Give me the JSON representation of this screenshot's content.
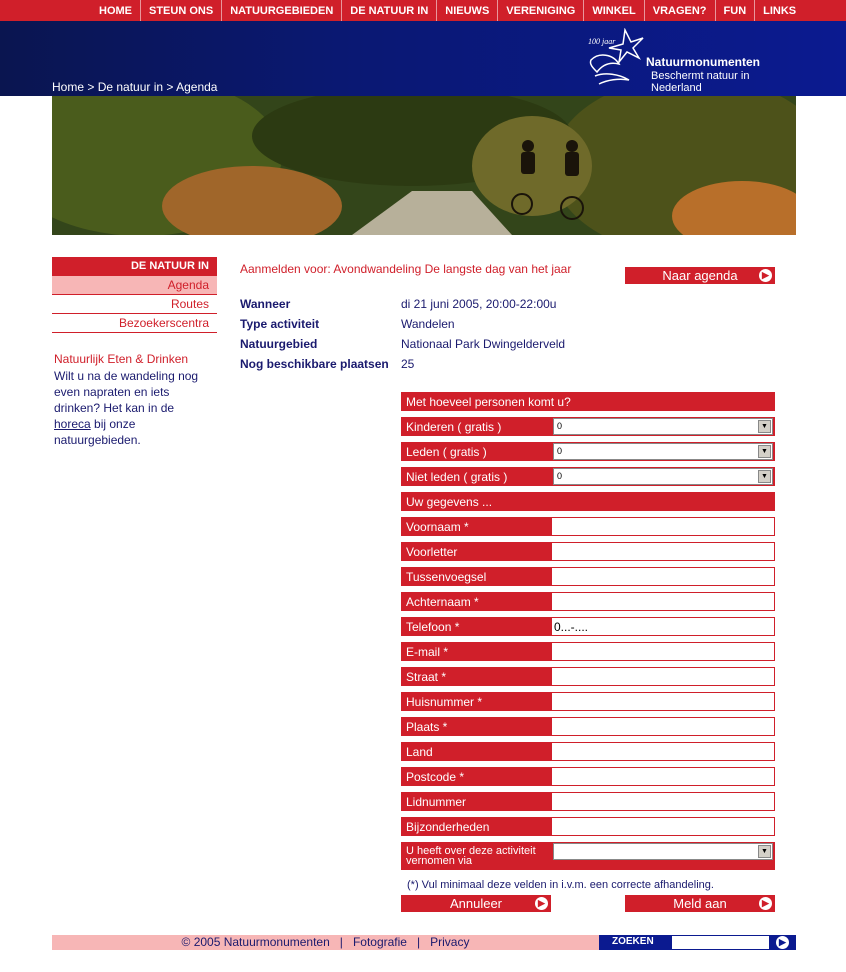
{
  "nav": [
    "HOME",
    "STEUN ONS",
    "NATUURGEBIEDEN",
    "DE NATUUR IN",
    "NIEUWS",
    "VERENIGING",
    "WINKEL",
    "VRAGEN?",
    "FUN",
    "LINKS"
  ],
  "breadcrumb": {
    "home": "Home",
    "sep1": " > ",
    "section": "De natuur in",
    "sep2": " > ",
    "current": "Agenda"
  },
  "logo": {
    "anniversary": "100 jaar",
    "name": "Natuurmonumenten",
    "tagline": "Beschermt natuur in Nederland"
  },
  "sidebar": {
    "heading": "DE NATUUR IN",
    "items": [
      {
        "label": "Agenda",
        "active": true
      },
      {
        "label": "Routes",
        "active": false
      },
      {
        "label": "Bezoekerscentra",
        "active": false
      }
    ],
    "promo_title": "Natuurlijk Eten & Drinken",
    "promo_text_before": "Wilt u na de wandeling nog even napraten en iets drinken? Het kan in de ",
    "promo_link": "horeca",
    "promo_text_after": " bij onze natuurgebieden."
  },
  "main": {
    "title": "Aanmelden voor: Avondwandeling De langste dag van het jaar",
    "agenda_button": "Naar agenda",
    "info": [
      {
        "label": "Wanneer",
        "value": "di 21 juni 2005, 20:00-22:00u"
      },
      {
        "label": "Type activiteit",
        "value": "Wandelen"
      },
      {
        "label": "Natuurgebied",
        "value": "Nationaal Park Dwingelderveld"
      },
      {
        "label": "Nog beschikbare plaatsen",
        "value": "25"
      }
    ]
  },
  "form": {
    "persons_header": "Met hoeveel personen komt u?",
    "persons": [
      {
        "label": "Kinderen  ( gratis )",
        "value": "0"
      },
      {
        "label": "Leden  ( gratis )",
        "value": "0"
      },
      {
        "label": "Niet leden  ( gratis )",
        "value": "0"
      }
    ],
    "details_header": "Uw gegevens ...",
    "fields": [
      {
        "label": "Voornaam *",
        "value": ""
      },
      {
        "label": "Voorletter",
        "value": ""
      },
      {
        "label": "Tussenvoegsel",
        "value": ""
      },
      {
        "label": "Achternaam *",
        "value": ""
      },
      {
        "label": "Telefoon *",
        "value": "0...-...."
      },
      {
        "label": "E-mail *",
        "value": ""
      },
      {
        "label": "Straat *",
        "value": ""
      },
      {
        "label": "Huisnummer *",
        "value": ""
      },
      {
        "label": "Plaats *",
        "value": ""
      },
      {
        "label": "Land",
        "value": ""
      },
      {
        "label": "Postcode *",
        "value": ""
      },
      {
        "label": "Lidnummer",
        "value": ""
      },
      {
        "label": "Bijzonderheden",
        "value": ""
      }
    ],
    "source_label": "U heeft over deze activiteit vernomen via",
    "source_value": "",
    "note": "(*) Vul minimaal deze velden in i.v.m. een correcte afhandeling.",
    "cancel_button": "Annuleer",
    "submit_button": "Meld aan"
  },
  "footer": {
    "copyright": "© 2005 Natuurmonumenten",
    "sep": "|",
    "links": [
      "Fotografie",
      "Privacy"
    ],
    "search_label": "ZOEKEN",
    "search_value": ""
  },
  "colors": {
    "brand_red": "#d01f2a",
    "brand_blue": "#0b1a90",
    "pink": "#f7b6b6",
    "text_navy": "#1a1a6e"
  }
}
